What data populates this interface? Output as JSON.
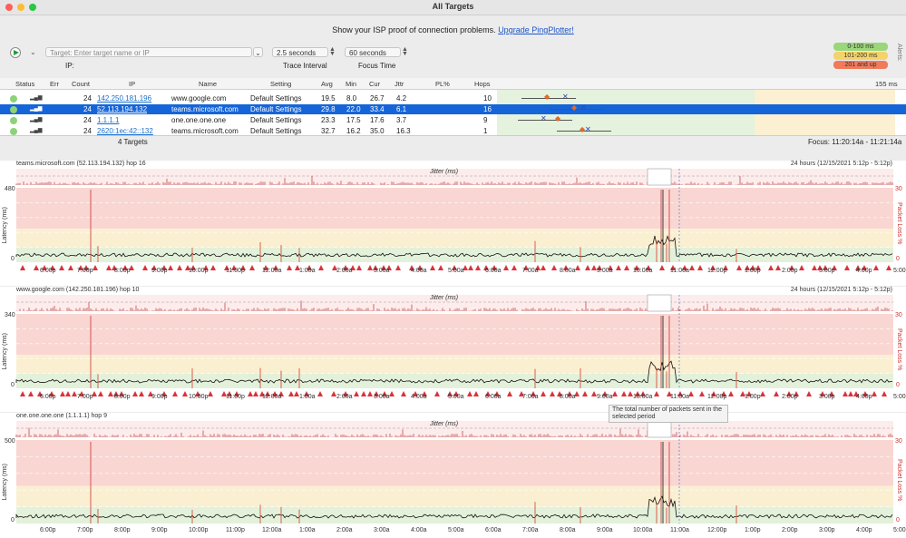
{
  "window": {
    "title": "All Targets"
  },
  "promo": {
    "text": "Show your ISP proof of connection problems.",
    "link": "Upgrade PingPlotter!"
  },
  "controls": {
    "target_placeholder": "Target:  Enter target name or IP",
    "interval": "2.5 seconds",
    "focus": "60 seconds",
    "ip_label": "IP:",
    "interval_label": "Trace Interval",
    "focus_label": "Focus Time",
    "alerts": "Alerts:"
  },
  "legend": [
    {
      "label": "0-100 ms",
      "color": "#9bd67a"
    },
    {
      "label": "101-200 ms",
      "color": "#f3d36a"
    },
    {
      "label": "201 and up",
      "color": "#f07a5a"
    }
  ],
  "table": {
    "columns": [
      "Status",
      "Err",
      "Count",
      "IP",
      "Name",
      "Setting",
      "Avg",
      "Min",
      "Cur",
      "Jttr",
      "PL%",
      "Hops"
    ],
    "scale_label": "155 ms",
    "rows": [
      {
        "count": "24",
        "ip": "142.250.181.196",
        "name": "www.google.com",
        "setting": "Default Settings",
        "avg": "19.5",
        "min": "8.0",
        "cur": "26.7",
        "jttr": "4.2",
        "hops": "10",
        "selected": false
      },
      {
        "count": "24",
        "ip": "52.113.194.132",
        "name": "teams.microsoft.com",
        "setting": "Default Settings",
        "avg": "29.8",
        "min": "22.0",
        "cur": "33.4",
        "jttr": "6.1",
        "hops": "16",
        "selected": true
      },
      {
        "count": "24",
        "ip": "1.1.1.1",
        "name": "one.one.one.one",
        "setting": "Default Settings",
        "avg": "23.3",
        "min": "17.5",
        "cur": "17.6",
        "jttr": "3.7",
        "hops": "9",
        "selected": false
      },
      {
        "count": "24",
        "ip": "2620:1ec:42::132",
        "name": "teams.microsoft.com",
        "setting": "Default Settings",
        "avg": "32.7",
        "min": "16.2",
        "cur": "35.0",
        "jttr": "16.3",
        "hops": "1",
        "selected": false
      }
    ],
    "footer_left": "4 Targets",
    "footer_right": "Focus: 11:20:14a - 11:21:14a"
  },
  "graphs": [
    {
      "title": "teams.microsoft.com (52.113.194.132) hop 16",
      "range": "24 hours (12/15/2021 5:12p - 5:12p)",
      "ymax": "480",
      "ymin": "0",
      "right_max": "30",
      "right_min": "0",
      "jitter": "Jitter (ms)",
      "ylabel": "Latency (ms)",
      "rlabel": "Packet Loss %",
      "show_times": true
    },
    {
      "title": "www.google.com (142.250.181.196) hop 10",
      "range": "24 hours (12/15/2021 5:12p - 5:12p)",
      "ymax": "340",
      "ymin": "0",
      "right_max": "30",
      "right_min": "0",
      "jitter": "Jitter (ms)",
      "ylabel": "Latency (ms)",
      "rlabel": "Packet Loss %",
      "show_times": true
    },
    {
      "title": "one.one.one.one (1.1.1.1) hop 9",
      "range": "",
      "ymax": "500",
      "ymin": "0",
      "right_max": "30",
      "right_min": "0",
      "jitter": "Jitter (ms)",
      "ylabel": "Latency (ms)",
      "rlabel": "Packet Loss %",
      "show_times": true
    }
  ],
  "times": [
    "6:00p",
    "7:00p",
    "8:00p",
    "9:00p",
    "10:00p",
    "11:00p",
    "12:00a",
    "1:00a",
    "2:00a",
    "3:00a",
    "4:00a",
    "5:00a",
    "6:00a",
    "7:00a",
    "8:00a",
    "9:00a",
    "10:00a",
    "11:00a",
    "12:00p",
    "1:00p",
    "2:00p",
    "3:00p",
    "4:00p",
    "5:00p"
  ],
  "tooltip": "The total number of packets sent in the selected period"
}
